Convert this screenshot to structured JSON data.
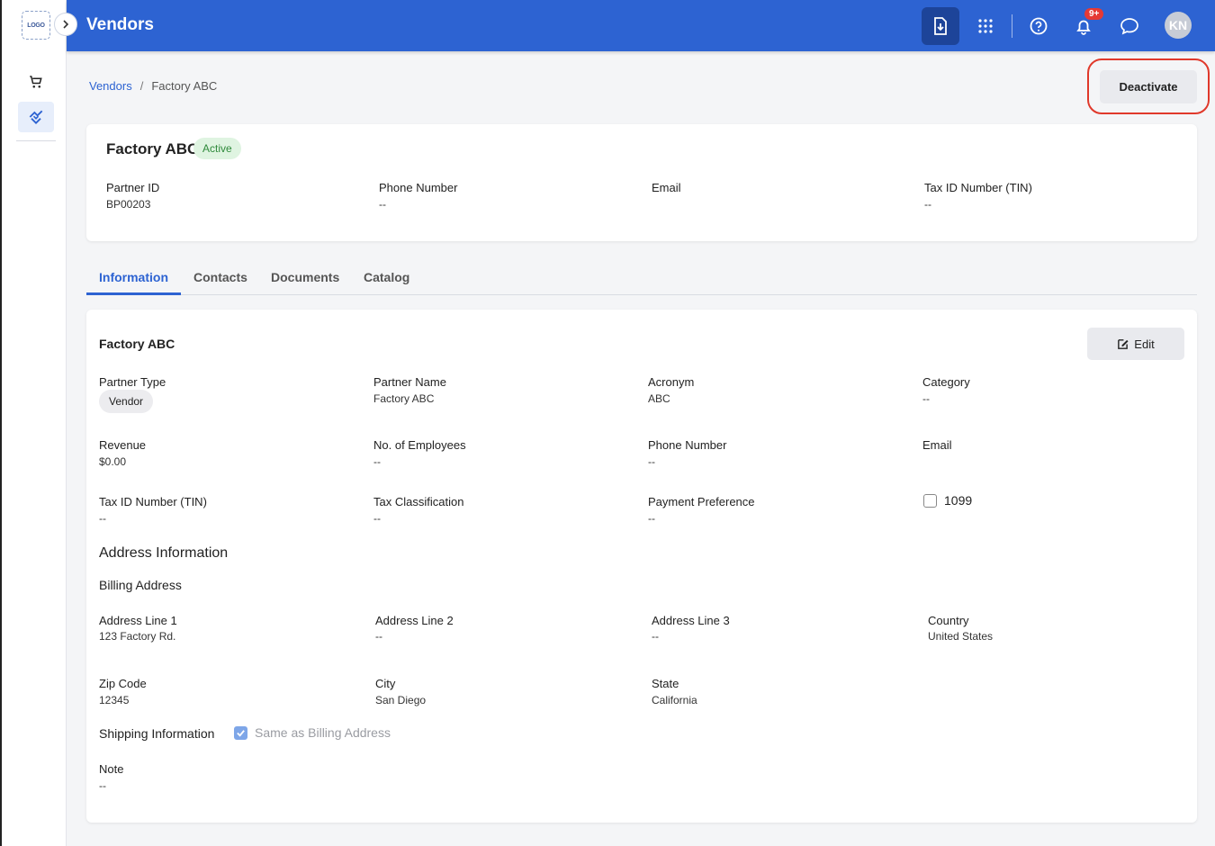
{
  "sidebar": {
    "logo_text": "LOGO",
    "items": [
      {
        "icon": "cart-icon"
      },
      {
        "icon": "vendor-icon",
        "active": true
      }
    ]
  },
  "header": {
    "title": "Vendors",
    "notification_count": "9+",
    "avatar_initials": "KN",
    "accent": "#2d63d2"
  },
  "breadcrumb": {
    "parent": "Vendors",
    "separator": "/",
    "current": "Factory ABC"
  },
  "actions": {
    "deactivate_label": "Deactivate"
  },
  "summary": {
    "name": "Factory ABC",
    "status": "Active",
    "fields": [
      {
        "label": "Partner ID",
        "value": "BP00203"
      },
      {
        "label": "Phone Number",
        "value": "--"
      },
      {
        "label": "Email",
        "value": ""
      },
      {
        "label": "Tax ID Number (TIN)",
        "value": "--"
      }
    ]
  },
  "tabs": [
    {
      "label": "Information",
      "active": true
    },
    {
      "label": "Contacts"
    },
    {
      "label": "Documents"
    },
    {
      "label": "Catalog"
    }
  ],
  "info": {
    "title": "Factory ABC",
    "edit_label": "Edit",
    "partner_type_label": "Partner Type",
    "partner_type_value": "Vendor",
    "fields": [
      {
        "label": "Partner Name",
        "value": "Factory ABC"
      },
      {
        "label": "Acronym",
        "value": "ABC"
      },
      {
        "label": "Category",
        "value": "--"
      },
      {
        "label": "Revenue",
        "value": "$0.00"
      },
      {
        "label": "No. of Employees",
        "value": "--"
      },
      {
        "label": "Phone Number",
        "value": "--"
      },
      {
        "label": "Email",
        "value": ""
      },
      {
        "label": "Tax ID Number (TIN)",
        "value": "--"
      },
      {
        "label": "Tax Classification",
        "value": "--"
      },
      {
        "label": "Payment Preference",
        "value": "--"
      }
    ],
    "checkbox_1099_label": "1099",
    "checkbox_1099_checked": false,
    "address_section_title": "Address Information",
    "billing_title": "Billing Address",
    "billing": [
      {
        "label": "Address Line 1",
        "value": "123 Factory Rd."
      },
      {
        "label": "Address Line 2",
        "value": "--"
      },
      {
        "label": "Address Line 3",
        "value": "--"
      },
      {
        "label": "Country",
        "value": "United States"
      },
      {
        "label": "Zip Code",
        "value": "12345"
      },
      {
        "label": "City",
        "value": "San Diego"
      },
      {
        "label": "State",
        "value": "California"
      }
    ],
    "shipping_title": "Shipping Information",
    "same_as_billing_label": "Same as Billing Address",
    "same_as_billing_checked": true,
    "note_label": "Note",
    "note_value": "--"
  }
}
